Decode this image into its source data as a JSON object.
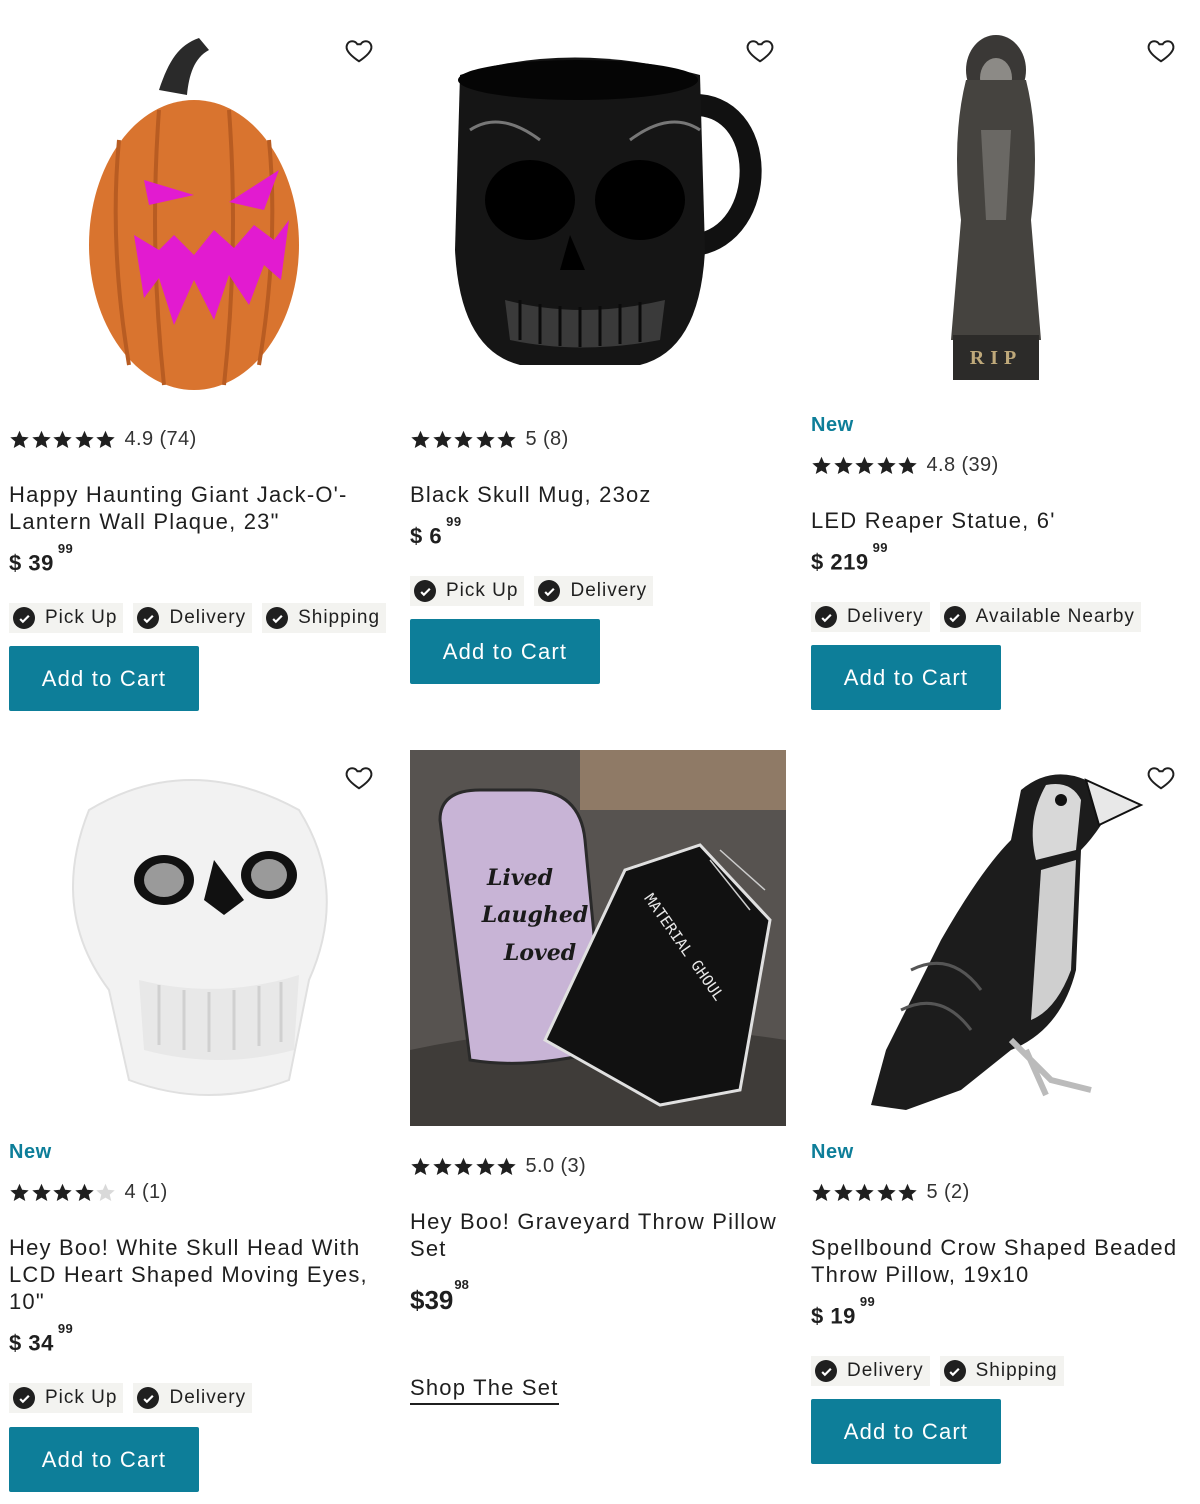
{
  "colors": {
    "accent": "#0d7e99",
    "text": "#1f1f1f",
    "chip_bg": "#f3f3f0"
  },
  "icons": {
    "wishlist": "heart-outline-icon",
    "check": "check-circle-icon",
    "star": "star-icon"
  },
  "products": [
    {
      "image": "jack-o-lantern-pumpkin",
      "rating_value": 4.9,
      "rating_text": "4.9 (74)",
      "title": "Happy Haunting Giant Jack-O'-Lantern Wall Plaque, 23\"",
      "price_main": "$ 39",
      "price_cents": "99",
      "fulfillment": [
        "Pick Up",
        "Delivery",
        "Shipping"
      ],
      "cta": "Add to Cart"
    },
    {
      "image": "black-skull-mug",
      "rating_value": 5,
      "rating_text": "5 (8)",
      "title": "Black Skull Mug, 23oz",
      "price_main": "$ 6",
      "price_cents": "99",
      "fulfillment": [
        "Pick Up",
        "Delivery"
      ],
      "cta": "Add to Cart"
    },
    {
      "image": "led-reaper-statue",
      "badge": "New",
      "rating_value": 4.8,
      "rating_text": "4.8 (39)",
      "title": "LED Reaper Statue, 6'",
      "price_main": "$ 219",
      "price_cents": "99",
      "fulfillment": [
        "Delivery",
        "Available Nearby"
      ],
      "cta": "Add to Cart",
      "image_text": "RIP"
    },
    {
      "image": "white-skull-head",
      "badge": "New",
      "rating_value": 4,
      "rating_text": "4 (1)",
      "title": "Hey Boo! White Skull Head With LCD Heart Shaped Moving Eyes, 10\"",
      "price_main": "$ 34",
      "price_cents": "99",
      "fulfillment": [
        "Pick Up",
        "Delivery"
      ],
      "cta": "Add to Cart"
    },
    {
      "image": "graveyard-pillow-set",
      "rating_value": 5.0,
      "rating_text": "5.0 (3)",
      "title": "Hey Boo! Graveyard Throw Pillow Set",
      "price_main": "$39",
      "price_cents": "98",
      "link": "Shop The Set",
      "image_text": [
        "Lived",
        "Laughed",
        "Loved",
        "MATERIAL GHOUL"
      ]
    },
    {
      "image": "beaded-crow-pillow",
      "badge": "New",
      "rating_value": 5,
      "rating_text": "5 (2)",
      "title": "Spellbound Crow Shaped Beaded Throw Pillow, 19x10",
      "price_main": "$ 19",
      "price_cents": "99",
      "fulfillment": [
        "Delivery",
        "Shipping"
      ],
      "cta": "Add to Cart"
    }
  ]
}
